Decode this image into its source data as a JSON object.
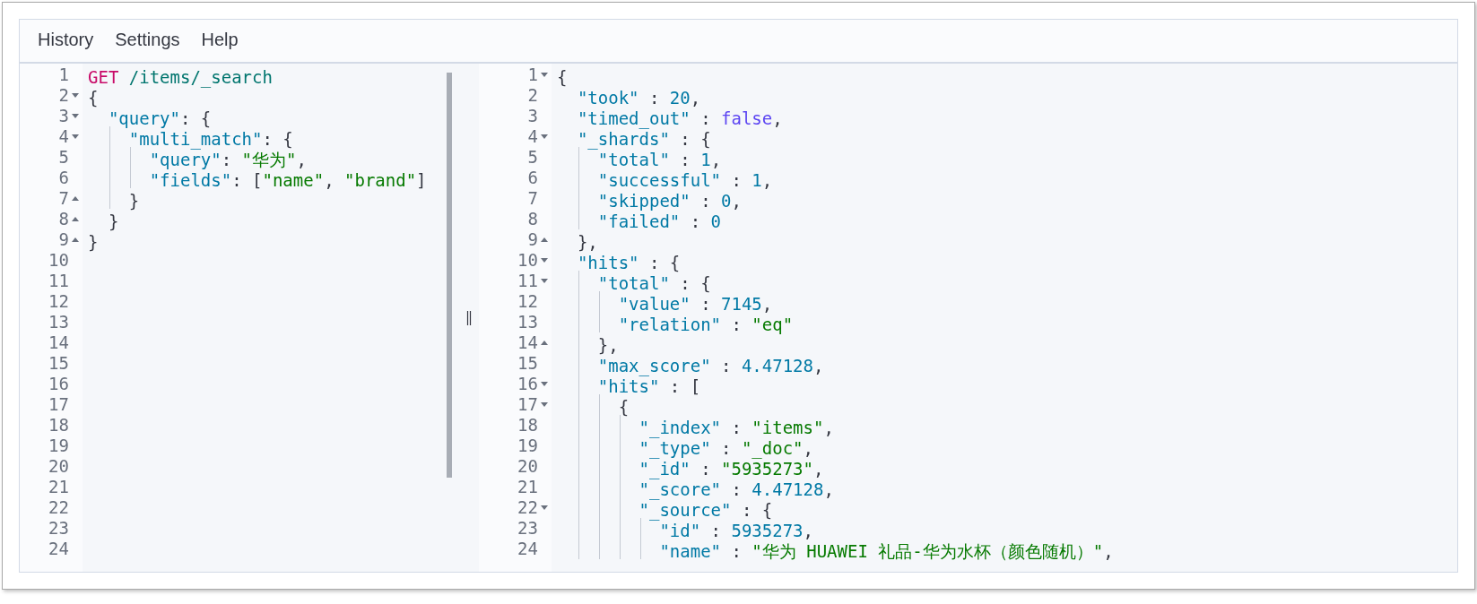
{
  "menu": [
    {
      "label": "History"
    },
    {
      "label": "Settings"
    },
    {
      "label": "Help"
    }
  ],
  "request_editor": {
    "lines": [
      {
        "number": "1",
        "tokens": [
          {
            "kind": "method",
            "text": "GET"
          },
          {
            "kind": "path",
            "text": " /items/_search"
          }
        ]
      },
      {
        "number": "2",
        "fold_open": true,
        "tokens": [
          {
            "kind": "punct",
            "text": "{"
          }
        ]
      },
      {
        "number": "3",
        "fold_open": true,
        "tokens": [
          {
            "kind": "key",
            "text": "  \"query\""
          },
          {
            "kind": "punct",
            "text": ": {"
          }
        ]
      },
      {
        "number": "4",
        "fold_open": true,
        "tokens": [
          {
            "kind": "key",
            "text": "    \"multi_match\""
          },
          {
            "kind": "punct",
            "text": ": {"
          }
        ]
      },
      {
        "number": "5",
        "tokens": [
          {
            "kind": "key",
            "text": "      \"query\""
          },
          {
            "kind": "punct",
            "text": ": "
          },
          {
            "kind": "string",
            "text": "\"华为\""
          },
          {
            "kind": "punct",
            "text": ","
          }
        ]
      },
      {
        "number": "6",
        "tokens": [
          {
            "kind": "key",
            "text": "      \"fields\""
          },
          {
            "kind": "punct",
            "text": ": ["
          },
          {
            "kind": "string",
            "text": "\"name\""
          },
          {
            "kind": "punct",
            "text": ", "
          },
          {
            "kind": "string",
            "text": "\"brand\""
          },
          {
            "kind": "punct",
            "text": "]"
          }
        ]
      },
      {
        "number": "7",
        "fold_close": true,
        "tokens": [
          {
            "kind": "punct",
            "text": "    }"
          }
        ]
      },
      {
        "number": "8",
        "fold_close": true,
        "tokens": [
          {
            "kind": "punct",
            "text": "  }"
          }
        ]
      },
      {
        "number": "9",
        "fold_close": true,
        "tokens": [
          {
            "kind": "punct",
            "text": "}"
          }
        ]
      },
      {
        "number": "10"
      },
      {
        "number": "11"
      },
      {
        "number": "12"
      },
      {
        "number": "13"
      },
      {
        "number": "14"
      },
      {
        "number": "15"
      },
      {
        "number": "16"
      },
      {
        "number": "17"
      },
      {
        "number": "18"
      },
      {
        "number": "19"
      },
      {
        "number": "20"
      },
      {
        "number": "21"
      },
      {
        "number": "22"
      },
      {
        "number": "23"
      },
      {
        "number": "24"
      }
    ]
  },
  "response_viewer": {
    "lines": [
      {
        "number": "1",
        "fold_open": true,
        "tokens": [
          {
            "kind": "punct",
            "text": "{"
          }
        ]
      },
      {
        "number": "2",
        "tokens": [
          {
            "kind": "key",
            "text": "  \"took\""
          },
          {
            "kind": "punct",
            "text": " : "
          },
          {
            "kind": "number",
            "text": "20"
          },
          {
            "kind": "punct",
            "text": ","
          }
        ]
      },
      {
        "number": "3",
        "tokens": [
          {
            "kind": "key",
            "text": "  \"timed_out\""
          },
          {
            "kind": "punct",
            "text": " : "
          },
          {
            "kind": "boolean",
            "text": "false"
          },
          {
            "kind": "punct",
            "text": ","
          }
        ]
      },
      {
        "number": "4",
        "fold_open": true,
        "tokens": [
          {
            "kind": "key",
            "text": "  \"_shards\""
          },
          {
            "kind": "punct",
            "text": " : {"
          }
        ]
      },
      {
        "number": "5",
        "tokens": [
          {
            "kind": "key",
            "text": "    \"total\""
          },
          {
            "kind": "punct",
            "text": " : "
          },
          {
            "kind": "number",
            "text": "1"
          },
          {
            "kind": "punct",
            "text": ","
          }
        ]
      },
      {
        "number": "6",
        "tokens": [
          {
            "kind": "key",
            "text": "    \"successful\""
          },
          {
            "kind": "punct",
            "text": " : "
          },
          {
            "kind": "number",
            "text": "1"
          },
          {
            "kind": "punct",
            "text": ","
          }
        ]
      },
      {
        "number": "7",
        "tokens": [
          {
            "kind": "key",
            "text": "    \"skipped\""
          },
          {
            "kind": "punct",
            "text": " : "
          },
          {
            "kind": "number",
            "text": "0"
          },
          {
            "kind": "punct",
            "text": ","
          }
        ]
      },
      {
        "number": "8",
        "tokens": [
          {
            "kind": "key",
            "text": "    \"failed\""
          },
          {
            "kind": "punct",
            "text": " : "
          },
          {
            "kind": "number",
            "text": "0"
          }
        ]
      },
      {
        "number": "9",
        "fold_close": true,
        "tokens": [
          {
            "kind": "punct",
            "text": "  },"
          }
        ]
      },
      {
        "number": "10",
        "fold_open": true,
        "tokens": [
          {
            "kind": "key",
            "text": "  \"hits\""
          },
          {
            "kind": "punct",
            "text": " : {"
          }
        ]
      },
      {
        "number": "11",
        "fold_open": true,
        "tokens": [
          {
            "kind": "key",
            "text": "    \"total\""
          },
          {
            "kind": "punct",
            "text": " : {"
          }
        ]
      },
      {
        "number": "12",
        "tokens": [
          {
            "kind": "key",
            "text": "      \"value\""
          },
          {
            "kind": "punct",
            "text": " : "
          },
          {
            "kind": "number",
            "text": "7145"
          },
          {
            "kind": "punct",
            "text": ","
          }
        ]
      },
      {
        "number": "13",
        "tokens": [
          {
            "kind": "key",
            "text": "      \"relation\""
          },
          {
            "kind": "punct",
            "text": " : "
          },
          {
            "kind": "string",
            "text": "\"eq\""
          }
        ]
      },
      {
        "number": "14",
        "fold_close": true,
        "tokens": [
          {
            "kind": "punct",
            "text": "    },"
          }
        ]
      },
      {
        "number": "15",
        "tokens": [
          {
            "kind": "key",
            "text": "    \"max_score\""
          },
          {
            "kind": "punct",
            "text": " : "
          },
          {
            "kind": "number",
            "text": "4.47128"
          },
          {
            "kind": "punct",
            "text": ","
          }
        ]
      },
      {
        "number": "16",
        "fold_open": true,
        "tokens": [
          {
            "kind": "key",
            "text": "    \"hits\""
          },
          {
            "kind": "punct",
            "text": " : ["
          }
        ]
      },
      {
        "number": "17",
        "fold_open": true,
        "tokens": [
          {
            "kind": "punct",
            "text": "      {"
          }
        ]
      },
      {
        "number": "18",
        "tokens": [
          {
            "kind": "key",
            "text": "        \"_index\""
          },
          {
            "kind": "punct",
            "text": " : "
          },
          {
            "kind": "string",
            "text": "\"items\""
          },
          {
            "kind": "punct",
            "text": ","
          }
        ]
      },
      {
        "number": "19",
        "tokens": [
          {
            "kind": "key",
            "text": "        \"_type\""
          },
          {
            "kind": "punct",
            "text": " : "
          },
          {
            "kind": "string",
            "text": "\"_doc\""
          },
          {
            "kind": "punct",
            "text": ","
          }
        ]
      },
      {
        "number": "20",
        "tokens": [
          {
            "kind": "key",
            "text": "        \"_id\""
          },
          {
            "kind": "punct",
            "text": " : "
          },
          {
            "kind": "string",
            "text": "\"5935273\""
          },
          {
            "kind": "punct",
            "text": ","
          }
        ]
      },
      {
        "number": "21",
        "tokens": [
          {
            "kind": "key",
            "text": "        \"_score\""
          },
          {
            "kind": "punct",
            "text": " : "
          },
          {
            "kind": "number",
            "text": "4.47128"
          },
          {
            "kind": "punct",
            "text": ","
          }
        ]
      },
      {
        "number": "22",
        "fold_open": true,
        "tokens": [
          {
            "kind": "key",
            "text": "        \"_source\""
          },
          {
            "kind": "punct",
            "text": " : {"
          }
        ]
      },
      {
        "number": "23",
        "tokens": [
          {
            "kind": "key",
            "text": "          \"id\""
          },
          {
            "kind": "punct",
            "text": " : "
          },
          {
            "kind": "number",
            "text": "5935273"
          },
          {
            "kind": "punct",
            "text": ","
          }
        ]
      },
      {
        "number": "24",
        "tokens": [
          {
            "kind": "key",
            "text": "          \"name\""
          },
          {
            "kind": "punct",
            "text": " : "
          },
          {
            "kind": "string",
            "text": "\"华为 HUAWEI 礼品-华为水杯（颜色随机）\""
          },
          {
            "kind": "punct",
            "text": ","
          }
        ]
      }
    ]
  }
}
